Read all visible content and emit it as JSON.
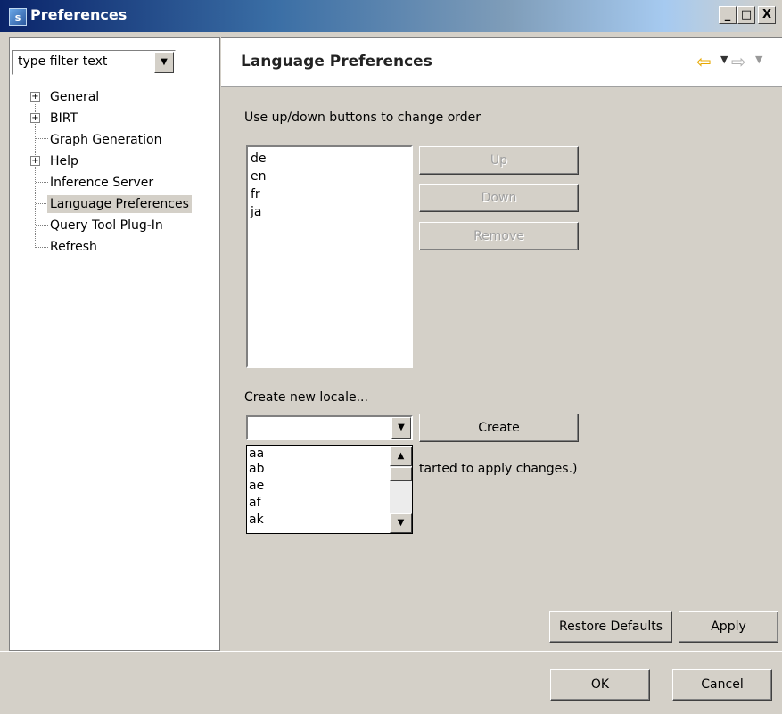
{
  "window": {
    "title": "Preferences",
    "app_icon_letter": "s",
    "minimize_glyph": "_",
    "maximize_glyph": "□",
    "close_glyph": "X"
  },
  "filter": {
    "value": "type filter text"
  },
  "tree": {
    "items": [
      {
        "label": "General",
        "expandable": true
      },
      {
        "label": "BIRT",
        "expandable": true
      },
      {
        "label": "Graph Generation",
        "expandable": false
      },
      {
        "label": "Help",
        "expandable": true
      },
      {
        "label": "Inference Server",
        "expandable": false
      },
      {
        "label": "Language Preferences",
        "expandable": false,
        "selected": true
      },
      {
        "label": "Query Tool Plug-In",
        "expandable": false
      },
      {
        "label": "Refresh",
        "expandable": false
      }
    ]
  },
  "page": {
    "title": "Language Preferences",
    "instructions": "Use up/down buttons to change order",
    "languages": [
      "de",
      "en",
      "fr",
      "ja"
    ],
    "buttons": {
      "up": "Up",
      "down": "Down",
      "remove": "Remove"
    },
    "create_label": "Create new locale...",
    "locale_combo_value": "",
    "create_button": "Create",
    "locale_options": [
      "aa",
      "ab",
      "ae",
      "af",
      "ak"
    ],
    "restart_note_visible": "tarted to apply changes.)"
  },
  "footer": {
    "restore_defaults": "Restore Defaults",
    "apply": "Apply",
    "ok": "OK",
    "cancel": "Cancel"
  },
  "colors": {
    "title_bar_start": "#0a246a",
    "nav_back_arrow": "#e8a800",
    "dialog_background": "#d4d0c8"
  }
}
